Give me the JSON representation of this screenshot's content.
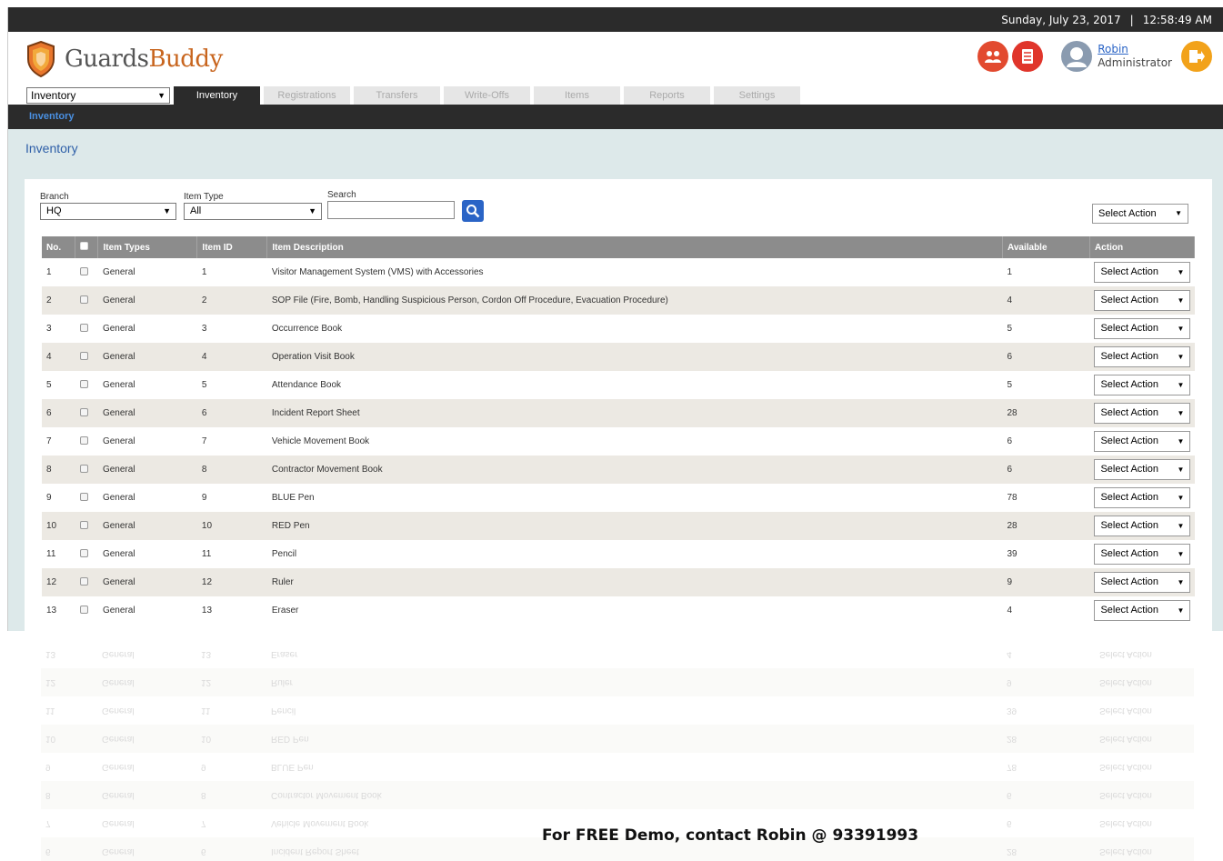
{
  "topbar": {
    "date": "Sunday, July 23, 2017",
    "separator": "|",
    "time": "12:58:49 AM"
  },
  "brand": {
    "name_part1": "Guards",
    "name_part2": "Buddy"
  },
  "user": {
    "name": "Robin",
    "role": "Administrator"
  },
  "module_select": {
    "value": "Inventory"
  },
  "tabs": [
    {
      "label": "Inventory",
      "active": true
    },
    {
      "label": "Registrations"
    },
    {
      "label": "Transfers"
    },
    {
      "label": "Write-Offs"
    },
    {
      "label": "Items"
    },
    {
      "label": "Reports"
    },
    {
      "label": "Settings"
    }
  ],
  "subnav": {
    "active": "Inventory"
  },
  "page": {
    "title": "Inventory"
  },
  "filters": {
    "branch_label": "Branch",
    "branch_value": "HQ",
    "item_type_label": "Item Type",
    "item_type_value": "All",
    "search_label": "Search",
    "search_value": "",
    "bulk_action": "Select Action"
  },
  "table": {
    "headers": {
      "no": "No.",
      "item_types": "Item Types",
      "item_id": "Item ID",
      "item_description": "Item Description",
      "available": "Available",
      "action": "Action"
    },
    "rows": [
      {
        "no": "1",
        "type": "General",
        "id": "1",
        "desc": "Visitor Management System (VMS) with Accessories",
        "available": "1",
        "action": "Select Action"
      },
      {
        "no": "2",
        "type": "General",
        "id": "2",
        "desc": "SOP File (Fire, Bomb, Handling Suspicious Person, Cordon Off Procedure, Evacuation Procedure)",
        "available": "4",
        "action": "Select Action"
      },
      {
        "no": "3",
        "type": "General",
        "id": "3",
        "desc": "Occurrence Book",
        "available": "5",
        "action": "Select Action"
      },
      {
        "no": "4",
        "type": "General",
        "id": "4",
        "desc": "Operation Visit Book",
        "available": "6",
        "action": "Select Action"
      },
      {
        "no": "5",
        "type": "General",
        "id": "5",
        "desc": "Attendance Book",
        "available": "5",
        "action": "Select Action"
      },
      {
        "no": "6",
        "type": "General",
        "id": "6",
        "desc": "Incident Report Sheet",
        "available": "28",
        "action": "Select Action"
      },
      {
        "no": "7",
        "type": "General",
        "id": "7",
        "desc": "Vehicle Movement Book",
        "available": "6",
        "action": "Select Action"
      },
      {
        "no": "8",
        "type": "General",
        "id": "8",
        "desc": "Contractor Movement Book",
        "available": "6",
        "action": "Select Action"
      },
      {
        "no": "9",
        "type": "General",
        "id": "9",
        "desc": "BLUE Pen",
        "available": "78",
        "action": "Select Action"
      },
      {
        "no": "10",
        "type": "General",
        "id": "10",
        "desc": "RED Pen",
        "available": "28",
        "action": "Select Action"
      },
      {
        "no": "11",
        "type": "General",
        "id": "11",
        "desc": "Pencil",
        "available": "39",
        "action": "Select Action"
      },
      {
        "no": "12",
        "type": "General",
        "id": "12",
        "desc": "Ruler",
        "available": "9",
        "action": "Select Action"
      },
      {
        "no": "13",
        "type": "General",
        "id": "13",
        "desc": "Eraser",
        "available": "4",
        "action": "Select Action"
      }
    ]
  },
  "promo": {
    "text": "For FREE Demo, contact Robin @ 93391993"
  }
}
